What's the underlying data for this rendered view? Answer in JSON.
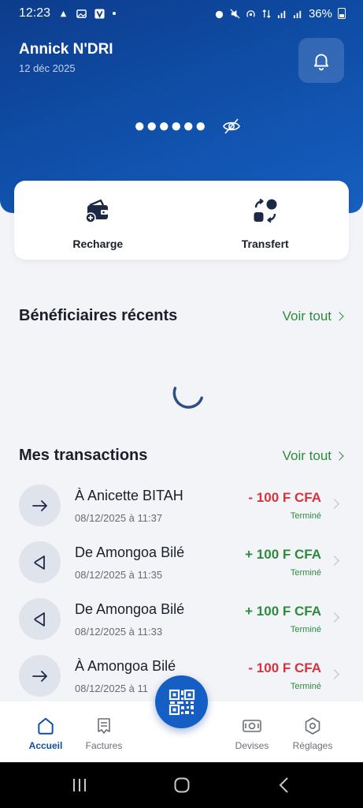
{
  "status_bar": {
    "time": "12:23",
    "battery": "36%"
  },
  "header": {
    "user_name": "Annick N'DRI",
    "date": "12 déc 2025",
    "balance_mask": "●●●●●●"
  },
  "actions": [
    {
      "label": "Recharge",
      "icon": "wallet-add-icon"
    },
    {
      "label": "Transfert",
      "icon": "transfer-icon"
    }
  ],
  "beneficiaries": {
    "title": "Bénéficiaires récents",
    "see_all": "Voir tout"
  },
  "transactions": {
    "title": "Mes transactions",
    "see_all": "Voir tout",
    "items": [
      {
        "name": "À Anicette BITAH",
        "date": "08/12/2025 à 11:37",
        "amount": "- 100 F CFA",
        "status": "Terminé",
        "direction": "out"
      },
      {
        "name": "De Amongoa Bilé",
        "date": "08/12/2025 à 11:35",
        "amount": "+ 100 F CFA",
        "status": "Terminé",
        "direction": "in"
      },
      {
        "name": "De Amongoa Bilé",
        "date": "08/12/2025 à 11:33",
        "amount": "+ 100 F CFA",
        "status": "Terminé",
        "direction": "in"
      },
      {
        "name": "À Amongoa Bilé",
        "date": "08/12/2025 à 11",
        "amount": "- 100 F CFA",
        "status": "Terminé",
        "direction": "out"
      }
    ]
  },
  "bottom_nav": [
    {
      "label": "Accueil",
      "icon": "home-icon",
      "active": true
    },
    {
      "label": "Factures",
      "icon": "invoice-icon",
      "active": false
    },
    {
      "label": "Devises",
      "icon": "currency-icon",
      "active": false
    },
    {
      "label": "Réglages",
      "icon": "settings-icon",
      "active": false
    }
  ],
  "colors": {
    "primary": "#0f4da6",
    "positive": "#2e8b3e",
    "negative": "#d8333b"
  }
}
